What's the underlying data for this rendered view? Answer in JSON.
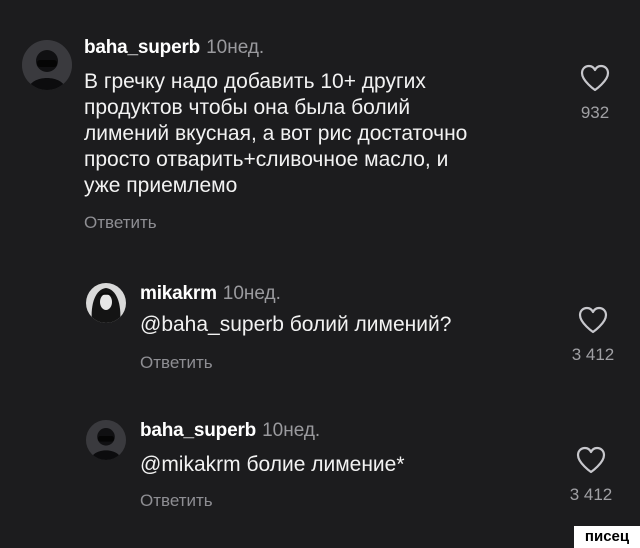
{
  "comments": [
    {
      "username": "baha_superb",
      "time": "10нед.",
      "text": "В гречку надо добавить 10+ других\nпродуктов чтобы она была болий\nлимений вкусная, а вот рис достаточно\nпросто отварить+сливочное масло, и\nуже приемлемо",
      "reply_label": "Ответить",
      "likes": "932",
      "avatar_icon": "masked-person-icon"
    },
    {
      "username": "mikakrm",
      "time": "10нед.",
      "text": "@baha_superb болий лимений?",
      "reply_label": "Ответить",
      "likes": "3 412",
      "avatar_icon": "dark-hair-person-icon"
    },
    {
      "username": "baha_superb",
      "time": "10нед.",
      "text": "@mikakrm болие лимение*",
      "reply_label": "Ответить",
      "likes": "3 412",
      "avatar_icon": "masked-person-icon"
    }
  ],
  "watermark": "писец",
  "colors": {
    "background": "#1c1c1e",
    "username": "#ffffff",
    "secondary": "#9a9a9e",
    "text": "#f2f2f2"
  }
}
